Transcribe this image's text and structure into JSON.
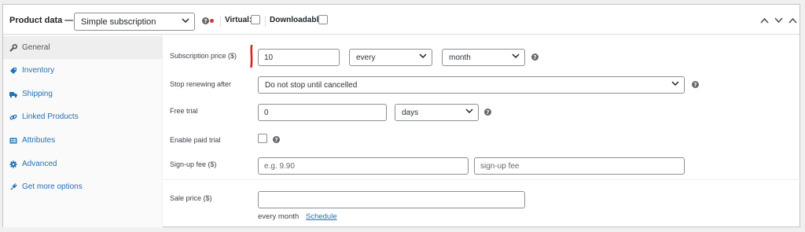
{
  "header": {
    "title": "Product data —",
    "product_type": "Simple subscription",
    "virtual_label": "Virtual:",
    "downloadable_label": "Downloadable:"
  },
  "sidebar": {
    "items": [
      {
        "label": "General",
        "icon": "wrench-icon",
        "active": true
      },
      {
        "label": "Inventory",
        "icon": "tag-icon"
      },
      {
        "label": "Shipping",
        "icon": "truck-icon"
      },
      {
        "label": "Linked Products",
        "icon": "link-icon"
      },
      {
        "label": "Attributes",
        "icon": "table-icon"
      },
      {
        "label": "Advanced",
        "icon": "gear-icon"
      },
      {
        "label": "Get more options",
        "icon": "plugin-icon"
      }
    ]
  },
  "fields": {
    "subscription_price": {
      "label": "Subscription price ($)",
      "value": "10",
      "interval": "every",
      "period": "month"
    },
    "stop_renewing": {
      "label": "Stop renewing after",
      "value": "Do not stop until cancelled"
    },
    "free_trial": {
      "label": "Free trial",
      "value": "0",
      "period": "days"
    },
    "paid_trial": {
      "label": "Enable paid trial"
    },
    "signup_fee": {
      "label": "Sign-up fee ($)",
      "placeholder": "e.g. 9.90",
      "label_placeholder": "sign-up fee"
    },
    "sale_price": {
      "label": "Sale price ($)",
      "value": "",
      "hint": "every month",
      "schedule_link": "Schedule"
    }
  },
  "colors": {
    "link": "#2271b1",
    "annotation": "#e02020"
  }
}
